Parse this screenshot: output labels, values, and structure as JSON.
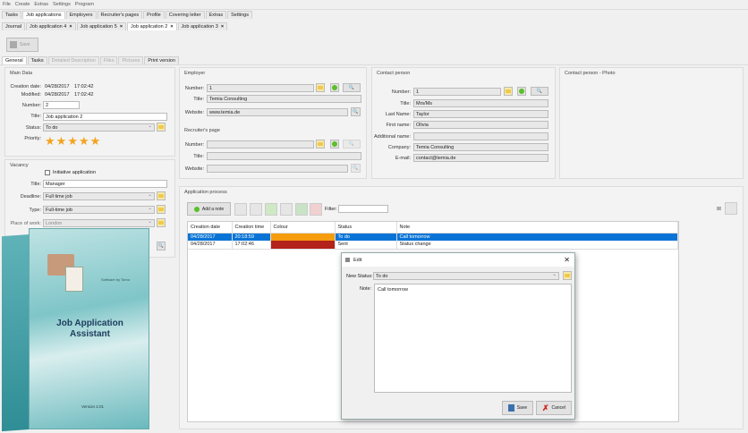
{
  "menu": [
    "File",
    "Create",
    "Extras",
    "Settings",
    "Program"
  ],
  "top_tabs": [
    "Tasks",
    "Job applications",
    "Employers",
    "Recruiter's pages",
    "Profile",
    "Covering letter",
    "Extras",
    "Settings"
  ],
  "doc_tabs": [
    "Journal",
    "Job application 4",
    "Job application 5",
    "Job application 2",
    "Job application 3"
  ],
  "save_label": "Save",
  "sub_tabs": [
    "General",
    "Tasks",
    "Detailed Description",
    "Files",
    "Pictures",
    "Print version"
  ],
  "main": {
    "heading": "Main Data",
    "creation_label": "Creation date:",
    "creation_date": "04/28/2017",
    "creation_time": "17:02:42",
    "modified_label": "Modified:",
    "modified_date": "04/28/2017",
    "modified_time": "17:02:42",
    "number_label": "Number:",
    "number": "2",
    "title_label": "Title:",
    "title": "Job application 2",
    "status_label": "Status:",
    "status": "To do",
    "priority_label": "Priority:",
    "priority": 5
  },
  "vacancy": {
    "heading": "Vacancy",
    "initiative": "Initiative application",
    "title_label": "Title:",
    "title": "Manager",
    "deadline_label": "Deadline:",
    "deadline": "Full time job",
    "type_label": "Type:",
    "type": "Full-time job",
    "place_label": "Place of work:",
    "place": "London"
  },
  "employer": {
    "heading": "Employer",
    "number_label": "Number:",
    "number": "1",
    "title_label": "Title:",
    "title": "Temia Consulting",
    "website_label": "Website:",
    "website": "www.temia.de"
  },
  "recruiter": {
    "heading": "Recruiter's page",
    "number_label": "Number:",
    "title_label": "Title:",
    "website_label": "Website:"
  },
  "contact": {
    "heading": "Contact person",
    "fields": [
      {
        "label": "Number:",
        "value": "1"
      },
      {
        "label": "Title:",
        "value": "Mrs/Ms"
      },
      {
        "label": "Last Name:",
        "value": "Taylor"
      },
      {
        "label": "First name:",
        "value": "Olivia"
      },
      {
        "label": "Additional name:",
        "value": ""
      },
      {
        "label": "Company:",
        "value": "Temia Consulting"
      },
      {
        "label": "E-mail:",
        "value": "contact@temia.de"
      }
    ]
  },
  "photo": {
    "heading": "Contact person - Photo"
  },
  "process": {
    "heading": "Application process",
    "add_note": "Add a note",
    "filter_label": "Filter:",
    "columns": [
      "Creation date",
      "Creation time",
      "Colour",
      "Status",
      "Note"
    ],
    "rows": [
      {
        "date": "04/28/2017",
        "time": "20:18:59",
        "colour": "#f59d0e",
        "status": "To do",
        "note": "Call tomorrow"
      },
      {
        "date": "04/28/2017",
        "time": "17:02:46",
        "colour": "#b3221b",
        "status": "Sent",
        "note": "Status change"
      }
    ]
  },
  "dialog": {
    "title": "Edit",
    "status_label": "New Status:",
    "status": "To do",
    "note_label": "Note:",
    "note": "Call tomorrow",
    "save": "Save",
    "cancel": "Cancel"
  },
  "box": {
    "title1": "Job Application",
    "title2": "Assistant",
    "brand": "Software by Tomo",
    "version": "Version 2.01"
  }
}
